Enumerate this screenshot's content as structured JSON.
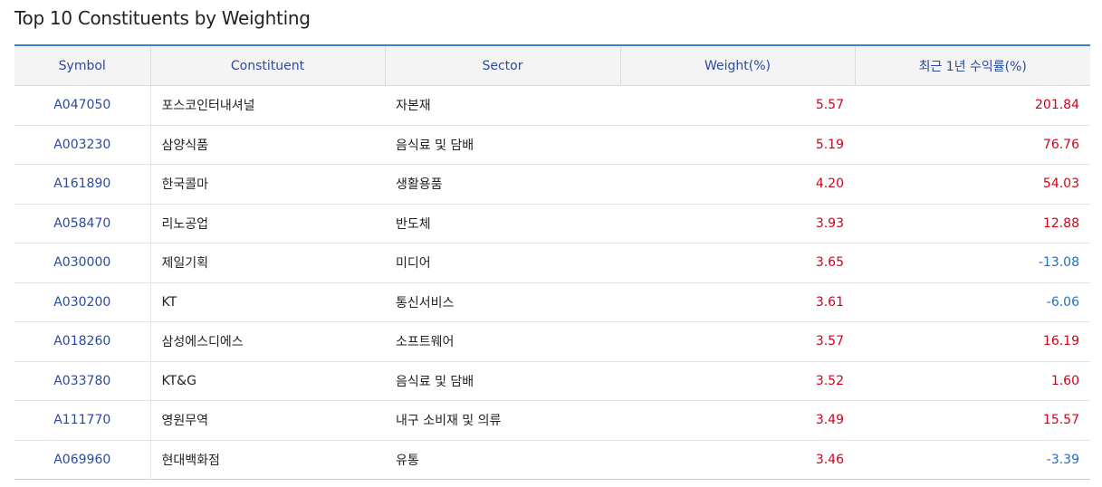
{
  "title": "Top 10 Constituents by Weighting",
  "table": {
    "headers": {
      "symbol": "Symbol",
      "constituent": "Constituent",
      "sector": "Sector",
      "weight": "Weight(%)",
      "return_1y": "최근 1년 수익률(%)"
    },
    "rows": [
      {
        "symbol": "A047050",
        "constituent": "포스코인터내셔널",
        "sector": "자본재",
        "weight": "5.57",
        "return_1y": "201.84"
      },
      {
        "symbol": "A003230",
        "constituent": "삼양식품",
        "sector": "음식료 및 담배",
        "weight": "5.19",
        "return_1y": "76.76"
      },
      {
        "symbol": "A161890",
        "constituent": "한국콜마",
        "sector": "생활용품",
        "weight": "4.20",
        "return_1y": "54.03"
      },
      {
        "symbol": "A058470",
        "constituent": "리노공업",
        "sector": "반도체",
        "weight": "3.93",
        "return_1y": "12.88"
      },
      {
        "symbol": "A030000",
        "constituent": "제일기획",
        "sector": "미디어",
        "weight": "3.65",
        "return_1y": "-13.08"
      },
      {
        "symbol": "A030200",
        "constituent": "KT",
        "sector": "통신서비스",
        "weight": "3.61",
        "return_1y": "-6.06"
      },
      {
        "symbol": "A018260",
        "constituent": "삼성에스디에스",
        "sector": "소프트웨어",
        "weight": "3.57",
        "return_1y": "16.19"
      },
      {
        "symbol": "A033780",
        "constituent": "KT&G",
        "sector": "음식료 및 담배",
        "weight": "3.52",
        "return_1y": "1.60"
      },
      {
        "symbol": "A111770",
        "constituent": "영원무역",
        "sector": "내구 소비재 및 의류",
        "weight": "3.49",
        "return_1y": "15.57"
      },
      {
        "symbol": "A069960",
        "constituent": "현대백화점",
        "sector": "유통",
        "weight": "3.46",
        "return_1y": "-3.39"
      }
    ]
  },
  "colors": {
    "accent_border": "#3d7fd1",
    "header_text": "#2b4aa0",
    "positive": "#d0021b",
    "negative": "#1f6fc2"
  }
}
